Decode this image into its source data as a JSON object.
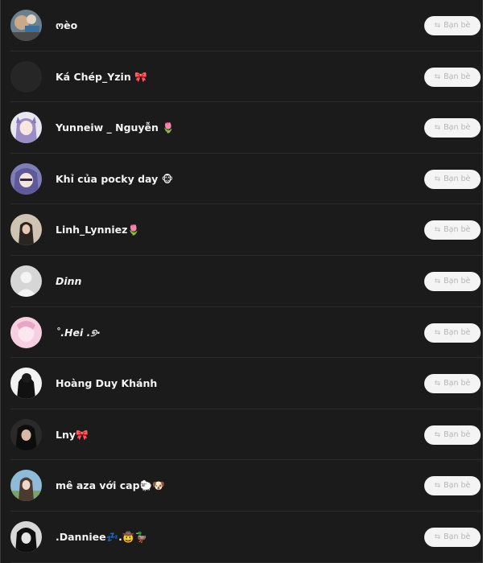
{
  "friends": [
    {
      "name": "ოèo",
      "italic": false,
      "avatar": "avatar-photo-icon",
      "button_label": "Bạn bè",
      "button_icon": "⇆"
    },
    {
      "name": "Ká Chép_Yzin 🎀",
      "italic": false,
      "avatar": "avatar-empty-icon",
      "button_label": "Bạn bè",
      "button_icon": "⇆"
    },
    {
      "name": "Yunneiw _ Nguyễn 🌷",
      "italic": false,
      "avatar": "avatar-anime-icon",
      "button_label": "Bạn bè",
      "button_icon": "⇆"
    },
    {
      "name": "Khỉ của pocky day 🐵",
      "italic": false,
      "avatar": "avatar-anime-icon",
      "button_label": "Bạn bè",
      "button_icon": "⇆"
    },
    {
      "name": "Linh_Lynniez🌷",
      "italic": false,
      "avatar": "avatar-photo-icon",
      "button_label": "Bạn bè",
      "button_icon": "⇆"
    },
    {
      "name": "Dinn",
      "italic": true,
      "avatar": "avatar-default-silhouette-icon",
      "button_label": "Bạn bè",
      "button_icon": "⇆"
    },
    {
      "name": "˚.Hei .୭·",
      "italic": true,
      "avatar": "avatar-pink-icon",
      "button_label": "Bạn bè",
      "button_icon": "⇆"
    },
    {
      "name": "Hoàng Duy Khánh",
      "italic": false,
      "avatar": "avatar-dark-photo-icon",
      "button_label": "Bạn bè",
      "button_icon": "⇆"
    },
    {
      "name": "Lny🎀",
      "italic": false,
      "avatar": "avatar-dark-photo-icon",
      "button_label": "Bạn bè",
      "button_icon": "⇆"
    },
    {
      "name": "mê aza với cap🐑🐶",
      "italic": false,
      "avatar": "avatar-photo-icon",
      "button_label": "Bạn bè",
      "button_icon": "⇆"
    },
    {
      "name": ".Danniee💤.🤠🦆",
      "italic": false,
      "avatar": "avatar-dark-photo-icon",
      "button_label": "Bạn bè",
      "button_icon": "⇆"
    }
  ],
  "colors": {
    "background": "#1b1b1b",
    "divider": "#2c2c2c",
    "button_bg": "#f4f4f4",
    "button_text": "#b6b6b6",
    "name_text": "#f3f3f3"
  }
}
